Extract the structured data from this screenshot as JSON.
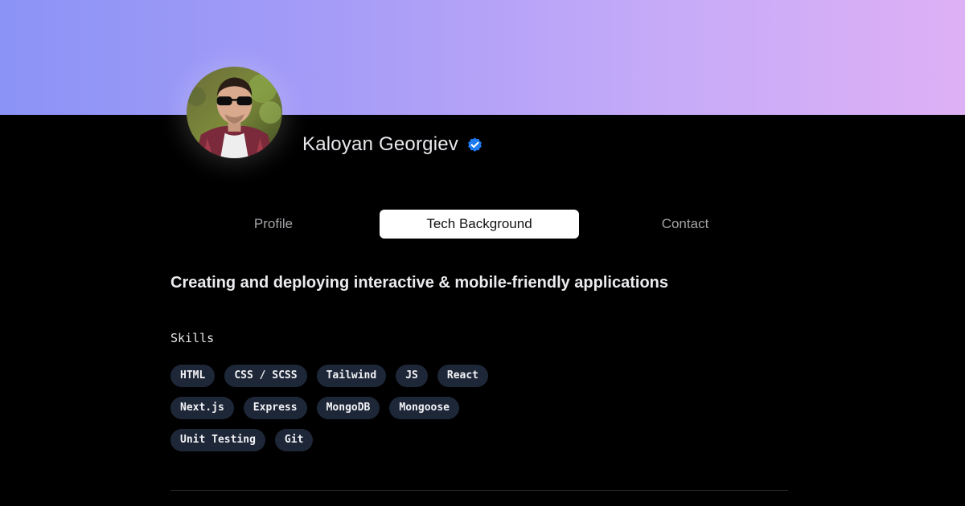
{
  "profile": {
    "name": "Kaloyan Georgiev",
    "verified_icon": "verified-badge-icon",
    "accent_color": "#1d7bf2"
  },
  "tabs": [
    {
      "label": "Profile",
      "active": false
    },
    {
      "label": "Tech Background",
      "active": true
    },
    {
      "label": "Contact",
      "active": false
    }
  ],
  "content": {
    "headline": "Creating and deploying interactive & mobile-friendly applications",
    "skills_label": "Skills",
    "skills": [
      "HTML",
      "CSS / SCSS",
      "Tailwind",
      "JS",
      "React",
      "Next.js",
      "Express",
      "MongoDB",
      "Mongoose",
      "Unit Testing",
      "Git"
    ]
  },
  "colors": {
    "banner_start": "#8b93f6",
    "banner_end": "#deb0f5",
    "chip_bg": "#1e2738",
    "page_bg": "#000000"
  }
}
